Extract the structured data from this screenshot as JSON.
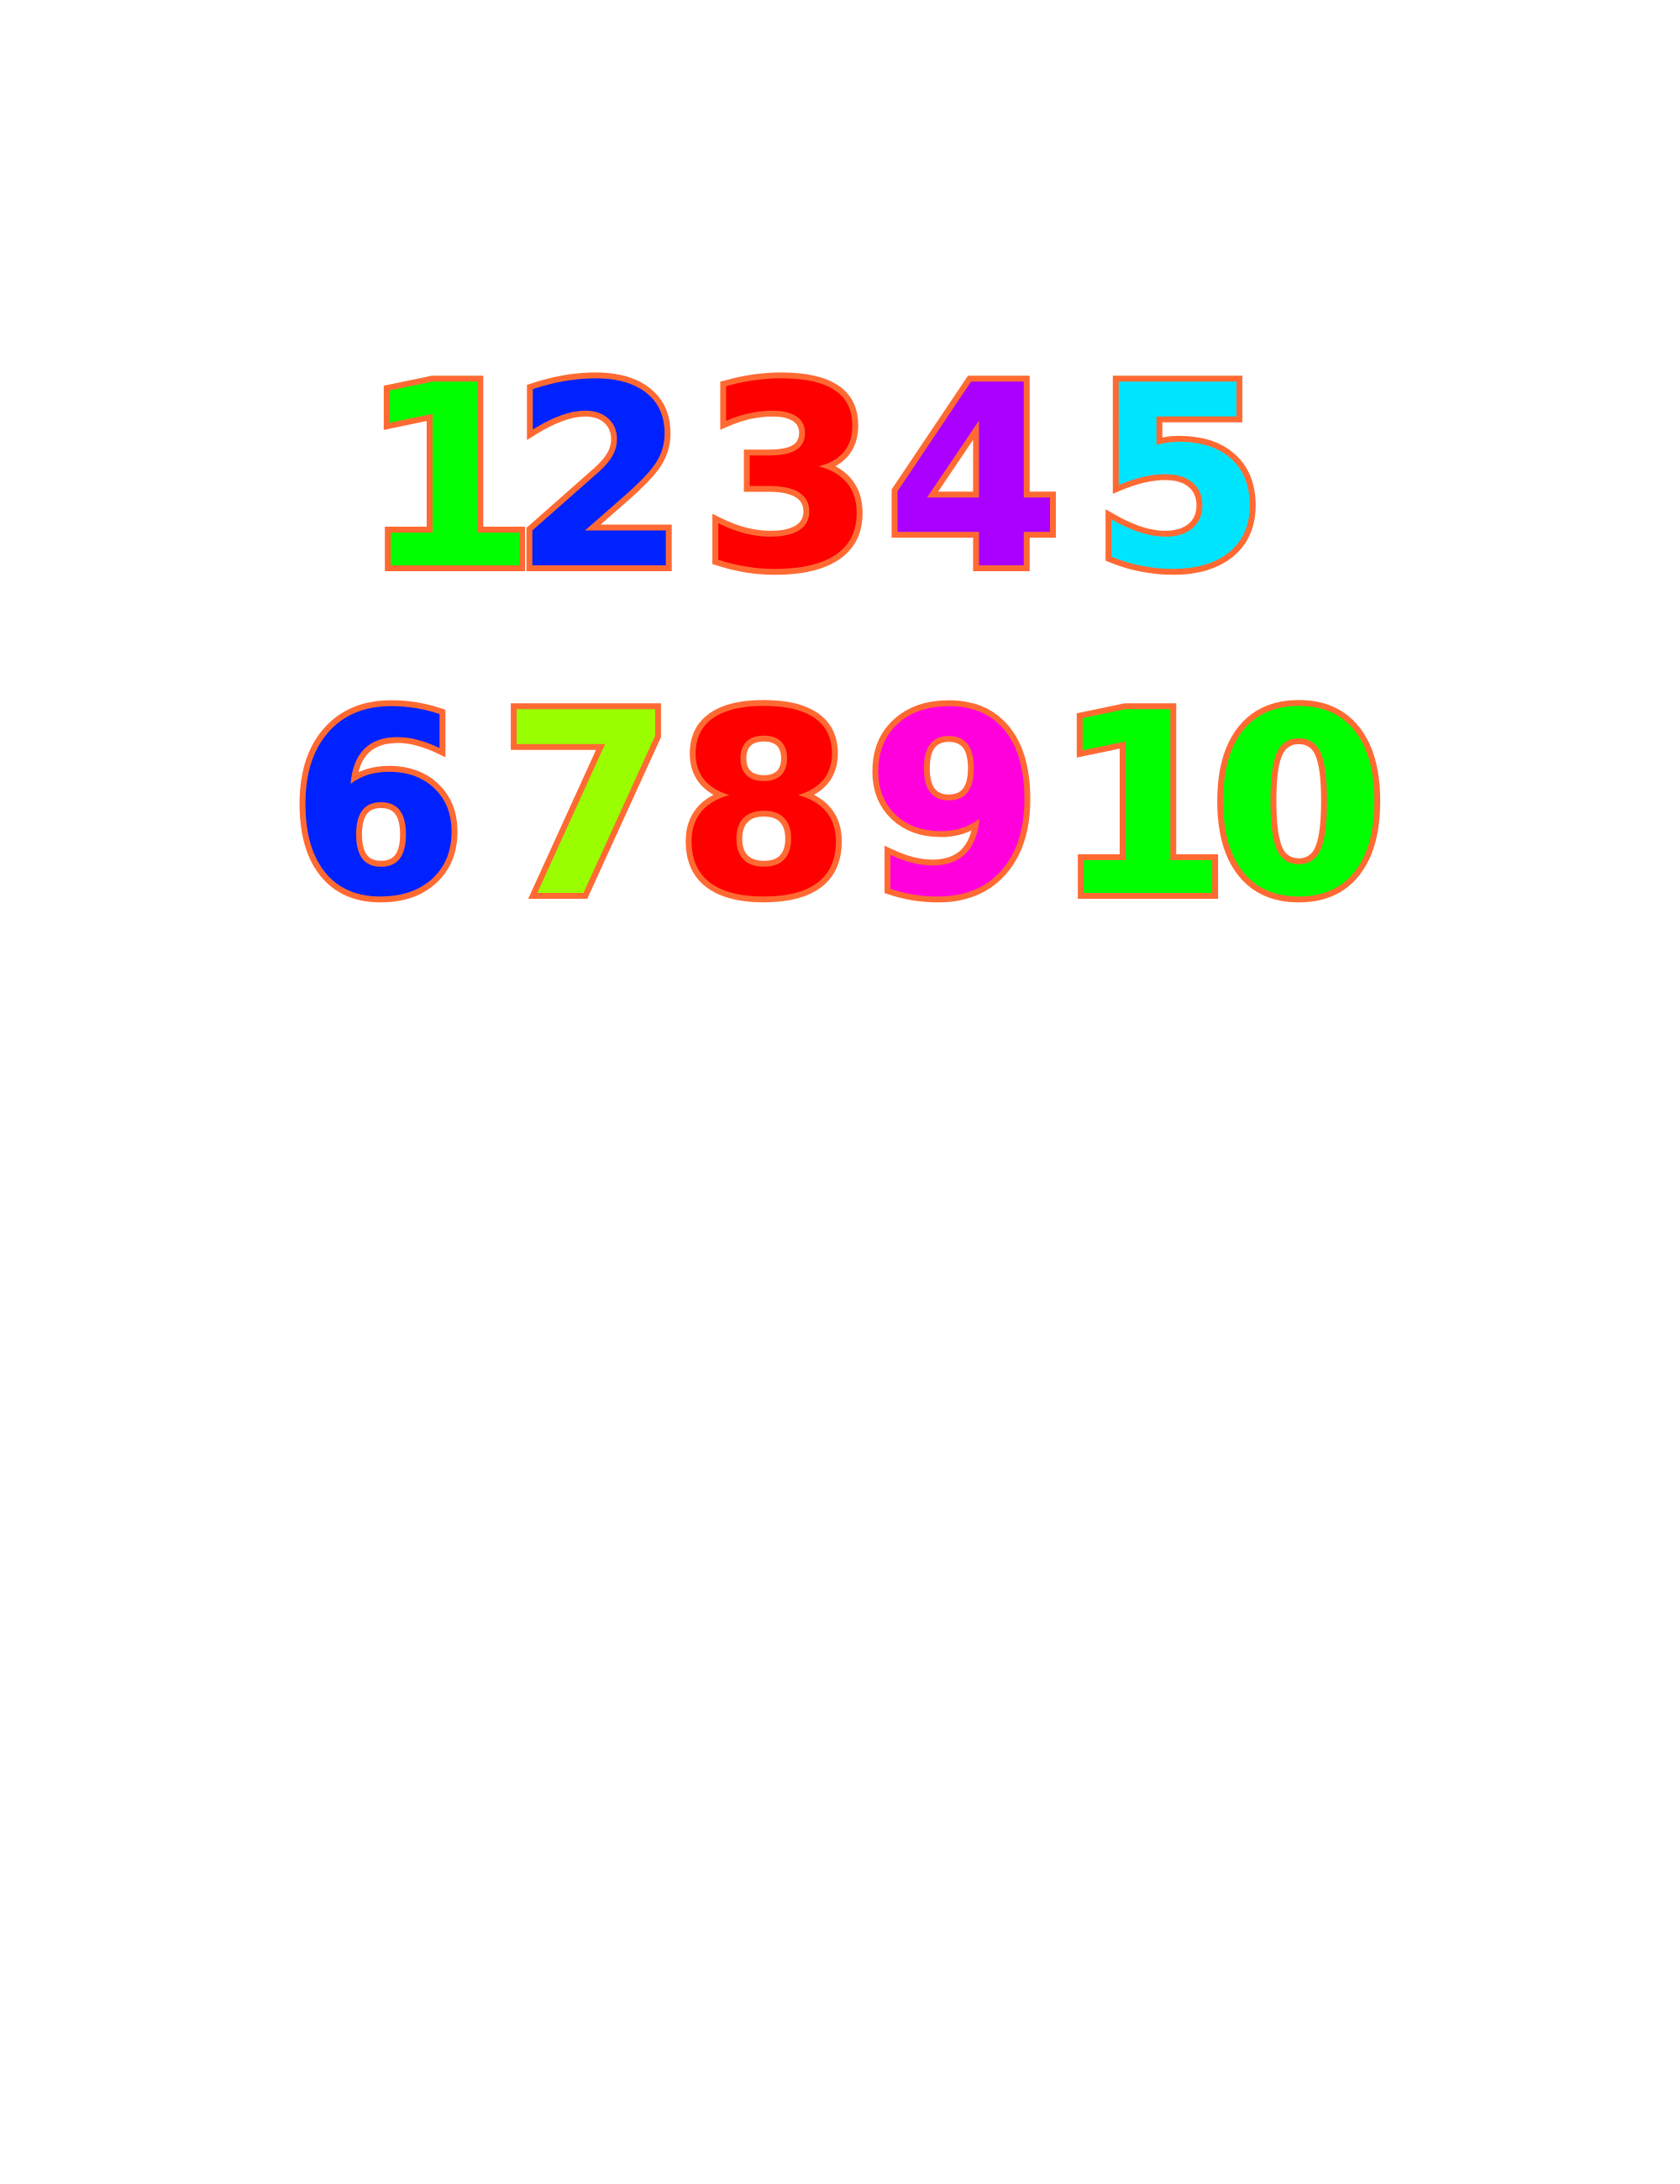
{
  "numbers": [
    {
      "label": "1",
      "color": "#00ff00"
    },
    {
      "label": "2",
      "color": "#0022ff"
    },
    {
      "label": "3",
      "color": "#ff0000"
    },
    {
      "label": "4",
      "color": "#aa00ff"
    },
    {
      "label": "5",
      "color": "#00e5ff"
    },
    {
      "label": "6",
      "color": "#0022ff"
    },
    {
      "label": "7",
      "color": "#99ff00"
    },
    {
      "label": "8",
      "color": "#ff0000"
    },
    {
      "label": "9",
      "color": "#ff00dd"
    },
    {
      "label": "10",
      "color": "#00ff00"
    }
  ],
  "outline_color": "#ff6a33",
  "background_color": "#ffffff"
}
